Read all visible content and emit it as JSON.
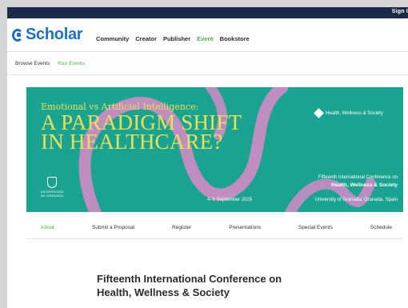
{
  "topbar": {
    "sign_in": "Sign I"
  },
  "brand": {
    "name": "Scholar",
    "color": "#1e6fc8",
    "icon": "scholar-logo-icon"
  },
  "main_nav": [
    {
      "label": "Community",
      "active": false
    },
    {
      "label": "Creator",
      "active": false
    },
    {
      "label": "Publisher",
      "active": false
    },
    {
      "label": "Event",
      "active": true
    },
    {
      "label": "Bookstore",
      "active": false
    }
  ],
  "sub_nav": [
    {
      "label": "Browse Events",
      "active": false
    },
    {
      "label": "Your Events",
      "active": true
    }
  ],
  "banner": {
    "line1": "Emotional vs Artificial Intelligence:",
    "line2": "A PARADIGM SHIFT",
    "line3": "IN HEALTHCARE?",
    "badge": "Health, Wellness & Society",
    "university": "UNIVERSIDAD DE GRANADA",
    "conf_line1": "Fifteenth International Conference on",
    "conf_line2": "Health, Wellness & Society",
    "date": "4–5 September 2025",
    "place": "University of Granada, Granada, Spain",
    "bg_color": "#1ba391",
    "text_color": "#e9e05a",
    "ribbon_color": "#c98cc4"
  },
  "event_tabs": [
    {
      "label": "About",
      "active": true
    },
    {
      "label": "Submit a Proposal",
      "active": false
    },
    {
      "label": "Register",
      "active": false
    },
    {
      "label": "Presentations",
      "active": false
    },
    {
      "label": "Special Events",
      "active": false
    },
    {
      "label": "Schedule",
      "active": false
    }
  ],
  "content": {
    "title_line1": "Fifteenth International Conference on",
    "title_line2": "Health, Wellness & Society"
  },
  "accent": "#4caf50"
}
